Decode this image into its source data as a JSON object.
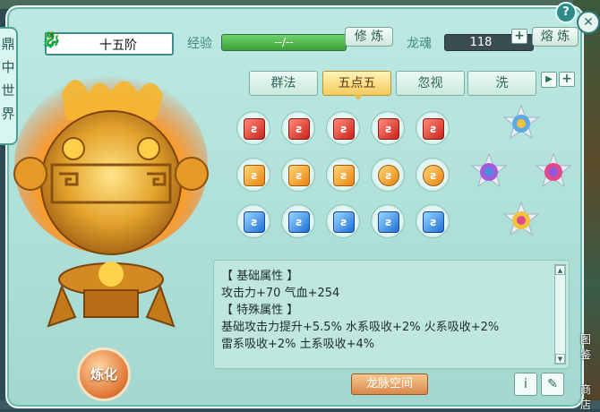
{
  "window": {
    "side_tab": [
      "鼎",
      "中",
      "世",
      "界"
    ],
    "help": "?",
    "close": "✕"
  },
  "header": {
    "stage": "十五阶",
    "exp_label": "经验",
    "exp_value": "--/--",
    "refine_button": "修 炼",
    "soul_label": "龙魂",
    "soul_value": "118",
    "smelt_button": "熔 炼"
  },
  "tabs": [
    {
      "label": "群法",
      "active": false
    },
    {
      "label": "五点五",
      "active": true
    },
    {
      "label": "忽视",
      "active": false
    },
    {
      "label": "洗",
      "active": false
    }
  ],
  "gems": {
    "rows": [
      {
        "color": "red",
        "count": 5
      },
      {
        "color": "orange",
        "count": 5
      },
      {
        "color": "blue",
        "count": 5
      }
    ],
    "star_gems": 4
  },
  "info": {
    "lines": [
      "【 基础属性 】",
      "攻击力+70  气血+254",
      "【 特殊属性 】",
      "基础攻击力提升+5.5%  水系吸收+2%  火系吸收+2%",
      "雷系吸收+2%  土系吸收+4%"
    ]
  },
  "buttons": {
    "refine_big": "炼化",
    "dragon_space": "龙脉空间",
    "info_icon": "i",
    "edit_icon": "✎"
  },
  "side_right": {
    "item1": "图鉴",
    "item2": "商店"
  },
  "colors": {
    "panel": "#aee0d8",
    "accent": "#3d8e8a",
    "active_tab": "#f2cb5e"
  }
}
